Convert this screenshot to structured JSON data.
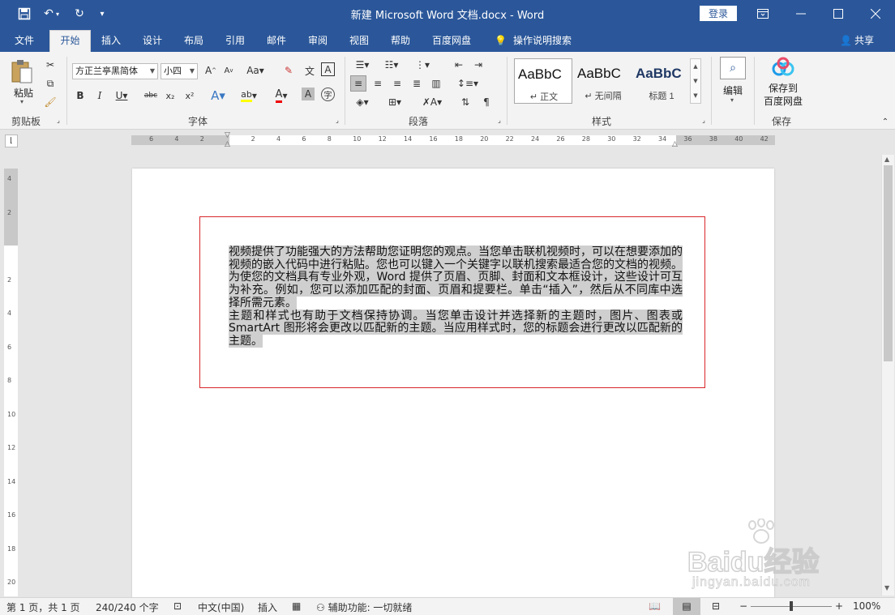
{
  "titlebar": {
    "doc_title": "新建 Microsoft Word 文档.docx  -  Word",
    "login": "登录"
  },
  "tabs": [
    "文件",
    "开始",
    "插入",
    "设计",
    "布局",
    "引用",
    "邮件",
    "审阅",
    "视图",
    "帮助",
    "百度网盘"
  ],
  "tell_me": "操作说明搜索",
  "share": "共享",
  "ribbon": {
    "clipboard": {
      "label": "剪贴板",
      "paste": "粘贴"
    },
    "font": {
      "label": "字体",
      "font_name": "方正兰亭黑简体",
      "font_size": "小四"
    },
    "paragraph": {
      "label": "段落"
    },
    "styles": {
      "label": "样式",
      "items": [
        {
          "sample": "AaBbC",
          "name": "↵ 正文"
        },
        {
          "sample": "AaBbC",
          "name": "↵ 无间隔"
        },
        {
          "sample": "AaBbC",
          "name": "标题 1"
        }
      ]
    },
    "editing": {
      "label": "编辑"
    },
    "save": {
      "label": "保存",
      "btn_line1": "保存到",
      "btn_line2": "百度网盘"
    }
  },
  "hruler_numbers": [
    "6",
    "4",
    "2",
    "",
    "2",
    "4",
    "6",
    "8",
    "10",
    "12",
    "14",
    "16",
    "18",
    "20",
    "22",
    "24",
    "26",
    "28",
    "30",
    "32",
    "34",
    "36",
    "38",
    "40",
    "42"
  ],
  "vruler_numbers": [
    "4",
    "2",
    "",
    "2",
    "4",
    "6",
    "8",
    "10",
    "12",
    "14",
    "16",
    "18",
    "20"
  ],
  "document": {
    "paragraphs": [
      "视频提供了功能强大的方法帮助您证明您的观点。当您单击联机视频时，可以在想要添加的视频的嵌入代码中进行粘贴。您也可以键入一个关键字以联机搜索最适合您的文档的视频。",
      "为使您的文档具有专业外观，Word 提供了页眉、页脚、封面和文本框设计，这些设计可互为补充。例如，您可以添加匹配的封面、页眉和提要栏。单击“插入”，然后从不同库中选择所需元素。",
      "主题和样式也有助于文档保持协调。当您单击设计并选择新的主题时，图片、图表或 SmartArt 图形将会更改以匹配新的主题。当应用样式时，您的标题会进行更改以匹配新的主题。"
    ]
  },
  "statusbar": {
    "page": "第 1 页，共 1 页",
    "words": "240/240 个字",
    "language": "中文(中国)",
    "mode": "插入",
    "accessibility": "辅助功能: 一切就绪",
    "zoom": "100%"
  },
  "watermark": {
    "text": "Baidu经验",
    "url": "jingyan.baidu.com"
  },
  "colors": {
    "accent": "#2b579a",
    "textbox_border": "#d8262a",
    "highlight": "#cfcfcf"
  }
}
